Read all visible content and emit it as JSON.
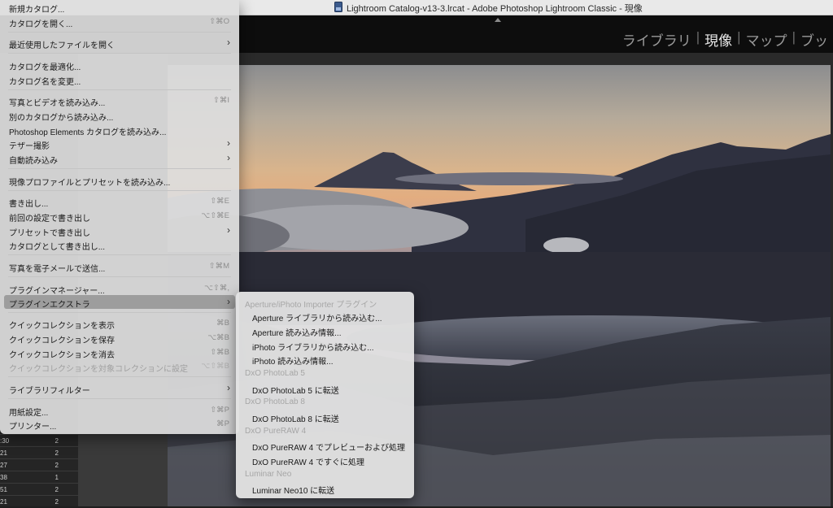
{
  "titlebar": {
    "title": "Lightroom Catalog-v13-3.lrcat - Adobe Photoshop Lightroom Classic - 現像"
  },
  "modules": [
    "ライブラリ",
    "現像",
    "マップ",
    "ブッ"
  ],
  "active_module": "現像",
  "file_menu": {
    "items": [
      {
        "label": "新規カタログ...",
        "shortcut": ""
      },
      {
        "label": "カタログを開く...",
        "shortcut": "⇧⌘O"
      },
      {
        "label": "最近使用したファイルを開く",
        "shortcut": ""
      },
      {
        "label": "カタログを最適化...",
        "shortcut": ""
      },
      {
        "label": "カタログ名を変更...",
        "shortcut": ""
      },
      {
        "label": "写真とビデオを読み込み...",
        "shortcut": "⇧⌘I"
      },
      {
        "label": "別のカタログから読み込み...",
        "shortcut": ""
      },
      {
        "label": "Photoshop Elements カタログを読み込み...",
        "shortcut": ""
      },
      {
        "label": "テザー撮影",
        "shortcut": ""
      },
      {
        "label": "自動読み込み",
        "shortcut": ""
      },
      {
        "label": "現像プロファイルとプリセットを読み込み...",
        "shortcut": ""
      },
      {
        "label": "書き出し...",
        "shortcut": "⇧⌘E"
      },
      {
        "label": "前回の設定で書き出し",
        "shortcut": "⌥⇧⌘E"
      },
      {
        "label": "プリセットで書き出し",
        "shortcut": ""
      },
      {
        "label": "カタログとして書き出し...",
        "shortcut": ""
      },
      {
        "label": "写真を電子メールで送信...",
        "shortcut": "⇧⌘M"
      },
      {
        "label": "プラグインマネージャー...",
        "shortcut": "⌥⇧⌘,"
      },
      {
        "label": "プラグインエクストラ",
        "shortcut": ""
      },
      {
        "label": "クイックコレクションを表示",
        "shortcut": "⌘B"
      },
      {
        "label": "クイックコレクションを保存",
        "shortcut": "⌥⌘B"
      },
      {
        "label": "クイックコレクションを消去",
        "shortcut": "⇧⌘B"
      },
      {
        "label": "クイックコレクションを対象コレクションに設定",
        "shortcut": "⌥⇧⌘B"
      },
      {
        "label": "ライブラリフィルター",
        "shortcut": ""
      },
      {
        "label": "用紙設定...",
        "shortcut": "⇧⌘P"
      },
      {
        "label": "プリンター...",
        "shortcut": "⌘P"
      }
    ]
  },
  "plugin_extras_submenu": {
    "items": [
      {
        "label": "Aperture/iPhoto Importer プラグイン"
      },
      {
        "label": "Aperture ライブラリから読み込む..."
      },
      {
        "label": "Aperture 読み込み情報..."
      },
      {
        "label": "iPhoto ライブラリから読み込む..."
      },
      {
        "label": "iPhoto 読み込み情報..."
      },
      {
        "label": "DxO PhotoLab 5"
      },
      {
        "label": "DxO PhotoLab 5 に転送"
      },
      {
        "label": "DxO PhotoLab 8"
      },
      {
        "label": "DxO PhotoLab 8 に転送"
      },
      {
        "label": "DxO PureRAW 4"
      },
      {
        "label": "DxO PureRAW 4 でプレビューおよび処理"
      },
      {
        "label": "DxO PureRAW 4 ですぐに処理"
      },
      {
        "label": "Luminar Neo"
      },
      {
        "label": "Luminar Neo10 に転送"
      }
    ]
  },
  "left_panel_rows": [
    {
      "a": ":30",
      "b": "2"
    },
    {
      "a": "21",
      "b": "2"
    },
    {
      "a": "27",
      "b": "2"
    },
    {
      "a": "38",
      "b": "1"
    },
    {
      "a": "51",
      "b": "2"
    },
    {
      "a": "21",
      "b": "2"
    }
  ],
  "colors": {
    "menu_bg": "#dedede",
    "highlight": "#9d9d9d",
    "module_bar": "#0d0d0d"
  }
}
